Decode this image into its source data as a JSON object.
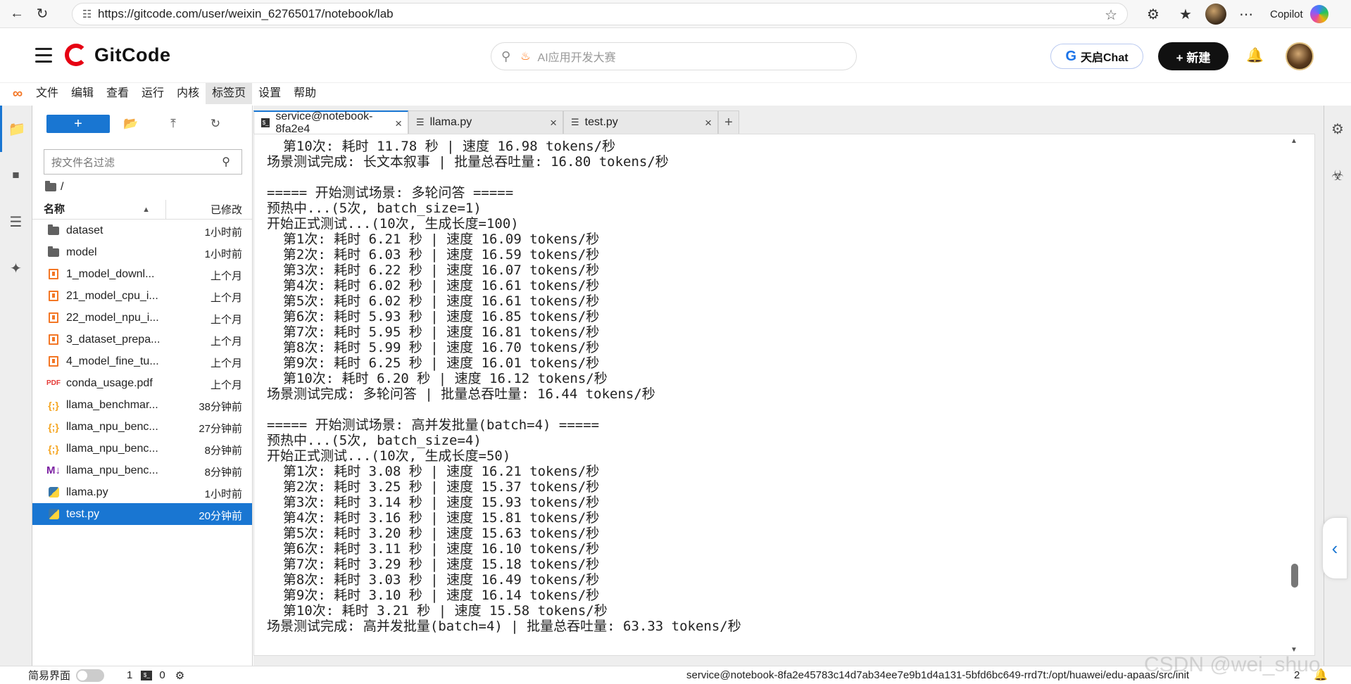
{
  "browser": {
    "url": "https://gitcode.com/user/weixin_62765017/notebook/lab",
    "copilot_label": "Copilot"
  },
  "site": {
    "logo_text": "GitCode",
    "search_placeholder": "AI应用开发大赛",
    "tianqi_chat_label": "天启Chat",
    "new_button_label": "+ 新建"
  },
  "menu": {
    "items": [
      "文件",
      "编辑",
      "查看",
      "运行",
      "内核",
      "标签页",
      "设置",
      "帮助"
    ],
    "active": "标签页"
  },
  "file_browser": {
    "filter_placeholder": "按文件名过滤",
    "breadcrumb": "/",
    "col_name": "名称",
    "col_modified": "已修改",
    "files": [
      {
        "name": "dataset",
        "type": "folder",
        "modified": "1小时前"
      },
      {
        "name": "model",
        "type": "folder",
        "modified": "1小时前"
      },
      {
        "name": "1_model_downl...",
        "type": "notebook",
        "modified": "上个月"
      },
      {
        "name": "21_model_cpu_i...",
        "type": "notebook",
        "modified": "上个月"
      },
      {
        "name": "22_model_npu_i...",
        "type": "notebook",
        "modified": "上个月"
      },
      {
        "name": "3_dataset_prepa...",
        "type": "notebook",
        "modified": "上个月"
      },
      {
        "name": "4_model_fine_tu...",
        "type": "notebook",
        "modified": "上个月"
      },
      {
        "name": "conda_usage.pdf",
        "type": "pdf",
        "modified": "上个月"
      },
      {
        "name": "llama_benchmar...",
        "type": "json",
        "modified": "38分钟前"
      },
      {
        "name": "llama_npu_benc...",
        "type": "json",
        "modified": "27分钟前"
      },
      {
        "name": "llama_npu_benc...",
        "type": "json",
        "modified": "8分钟前"
      },
      {
        "name": "llama_npu_benc...",
        "type": "markdown",
        "modified": "8分钟前"
      },
      {
        "name": "llama.py",
        "type": "python",
        "modified": "1小时前"
      },
      {
        "name": "test.py",
        "type": "python",
        "modified": "20分钟前",
        "selected": true
      }
    ]
  },
  "tabs": [
    {
      "label": "service@notebook-8fa2e4",
      "kind": "terminal",
      "active": true
    },
    {
      "label": "llama.py",
      "kind": "file",
      "active": false
    },
    {
      "label": "test.py",
      "kind": "file",
      "active": false
    }
  ],
  "terminal_lines": [
    "  第10次: 耗时 11.78 秒 | 速度 16.98 tokens/秒",
    "场景测试完成: 长文本叙事 | 批量总吞吐量: 16.80 tokens/秒",
    "",
    "===== 开始测试场景: 多轮问答 =====",
    "预热中...(5次, batch_size=1)",
    "开始正式测试...(10次, 生成长度=100)",
    "  第1次: 耗时 6.21 秒 | 速度 16.09 tokens/秒",
    "  第2次: 耗时 6.03 秒 | 速度 16.59 tokens/秒",
    "  第3次: 耗时 6.22 秒 | 速度 16.07 tokens/秒",
    "  第4次: 耗时 6.02 秒 | 速度 16.61 tokens/秒",
    "  第5次: 耗时 6.02 秒 | 速度 16.61 tokens/秒",
    "  第6次: 耗时 5.93 秒 | 速度 16.85 tokens/秒",
    "  第7次: 耗时 5.95 秒 | 速度 16.81 tokens/秒",
    "  第8次: 耗时 5.99 秒 | 速度 16.70 tokens/秒",
    "  第9次: 耗时 6.25 秒 | 速度 16.01 tokens/秒",
    "  第10次: 耗时 6.20 秒 | 速度 16.12 tokens/秒",
    "场景测试完成: 多轮问答 | 批量总吞吐量: 16.44 tokens/秒",
    "",
    "===== 开始测试场景: 高并发批量(batch=4) =====",
    "预热中...(5次, batch_size=4)",
    "开始正式测试...(10次, 生成长度=50)",
    "  第1次: 耗时 3.08 秒 | 速度 16.21 tokens/秒",
    "  第2次: 耗时 3.25 秒 | 速度 15.37 tokens/秒",
    "  第3次: 耗时 3.14 秒 | 速度 15.93 tokens/秒",
    "  第4次: 耗时 3.16 秒 | 速度 15.81 tokens/秒",
    "  第5次: 耗时 3.20 秒 | 速度 15.63 tokens/秒",
    "  第6次: 耗时 3.11 秒 | 速度 16.10 tokens/秒",
    "  第7次: 耗时 3.29 秒 | 速度 15.18 tokens/秒",
    "  第8次: 耗时 3.03 秒 | 速度 16.49 tokens/秒",
    "  第9次: 耗时 3.10 秒 | 速度 16.14 tokens/秒",
    "  第10次: 耗时 3.21 秒 | 速度 15.58 tokens/秒",
    "场景测试完成: 高并发批量(batch=4) | 批量总吞吐量: 63.33 tokens/秒"
  ],
  "statusbar": {
    "simple_mode_label": "简易界面",
    "terminal_count": "1",
    "kernel_count": "0",
    "path": "service@notebook-8fa2e45783c14d7ab34ee7e9b1d4a131-5bfd6bc649-rrd7t:/opt/huawei/edu-apaas/src/init",
    "notification_count": "2"
  },
  "watermark": "CSDN @wei_shuo",
  "colors": {
    "accent": "#1976d2",
    "jupyter_orange": "#f37726",
    "gitcode_red": "#e60012"
  }
}
